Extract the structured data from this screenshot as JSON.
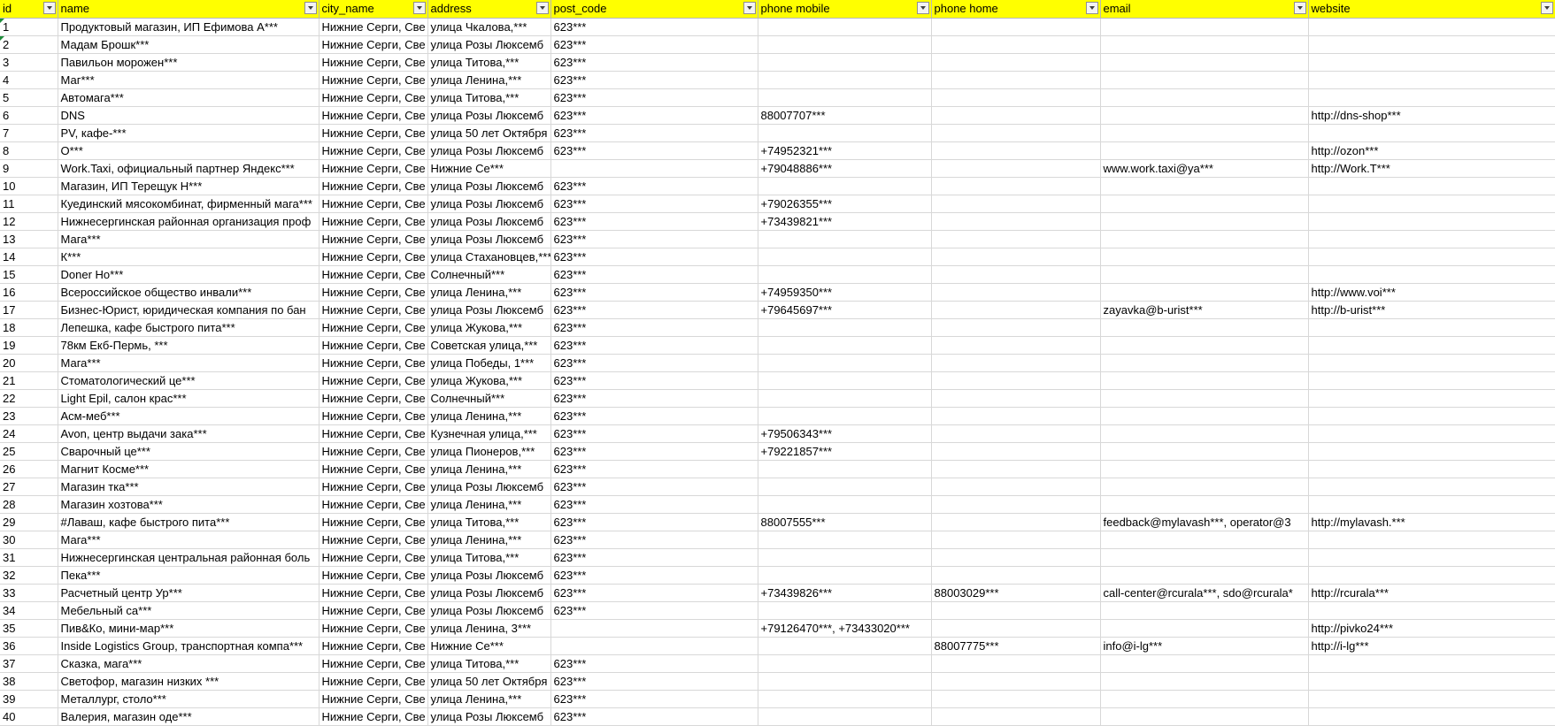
{
  "sheet": {
    "columns": [
      "id",
      "name",
      "city_name",
      "address",
      "post_code",
      "phone mobile",
      "phone home",
      "email",
      "website"
    ],
    "marked_ids": [
      1,
      2
    ],
    "rows": [
      [
        "1",
        "Продуктовый магазин, ИП Ефимова А***",
        "Нижние Серги, Све",
        "улица Чкалова,***",
        "623***",
        "",
        "",
        "",
        ""
      ],
      [
        "2",
        "Мадам Брошк***",
        "Нижние Серги, Све",
        "улица Розы Люксемб",
        "623***",
        "",
        "",
        "",
        ""
      ],
      [
        "3",
        "Павильон морожен***",
        "Нижние Серги, Све",
        "улица Титова,***",
        "623***",
        "",
        "",
        "",
        ""
      ],
      [
        "4",
        "Маг***",
        "Нижние Серги, Све",
        "улица Ленина,***",
        "623***",
        "",
        "",
        "",
        ""
      ],
      [
        "5",
        "Автомага***",
        "Нижние Серги, Све",
        "улица Титова,***",
        "623***",
        "",
        "",
        "",
        ""
      ],
      [
        "6",
        "DNS",
        "Нижние Серги, Све",
        "улица Розы Люксемб",
        "623***",
        "88007707***",
        "",
        "",
        "http://dns-shop***"
      ],
      [
        "7",
        "PV, кафе-***",
        "Нижние Серги, Све",
        "улица 50 лет Октября",
        "623***",
        "",
        "",
        "",
        ""
      ],
      [
        "8",
        "О***",
        "Нижние Серги, Све",
        "улица Розы Люксемб",
        "623***",
        "+74952321***",
        "",
        "",
        "http://ozon***"
      ],
      [
        "9",
        "Work.Taxi, официальный партнер Яндекс***",
        "Нижние Серги, Све",
        "Нижние Се***",
        "",
        "+79048886***",
        "",
        "www.work.taxi@ya***",
        "http://Work.T***"
      ],
      [
        "10",
        "Магазин, ИП Терещук Н***",
        "Нижние Серги, Све",
        "улица Розы Люксемб",
        "623***",
        "",
        "",
        "",
        ""
      ],
      [
        "11",
        "Куединский мясокомбинат, фирменный мага***",
        "Нижние Серги, Све",
        "улица Розы Люксемб",
        "623***",
        "+79026355***",
        "",
        "",
        ""
      ],
      [
        "12",
        "Нижнесергинская районная организация проф",
        "Нижние Серги, Све",
        "улица Розы Люксемб",
        "623***",
        "+73439821***",
        "",
        "",
        ""
      ],
      [
        "13",
        "Мага***",
        "Нижние Серги, Све",
        "улица Розы Люксемб",
        "623***",
        "",
        "",
        "",
        ""
      ],
      [
        "14",
        "К***",
        "Нижние Серги, Све",
        "улица Стахановцев,***",
        "623***",
        "",
        "",
        "",
        ""
      ],
      [
        "15",
        "Doner Ho***",
        "Нижние Серги, Све",
        "Солнечный***",
        "623***",
        "",
        "",
        "",
        ""
      ],
      [
        "16",
        "Всероссийское общество инвали***",
        "Нижние Серги, Све",
        "улица Ленина,***",
        "623***",
        "+74959350***",
        "",
        "",
        "http://www.voi***"
      ],
      [
        "17",
        "Бизнес-Юрист, юридическая компания по бан",
        "Нижние Серги, Све",
        "улица Розы Люксемб",
        "623***",
        "+79645697***",
        "",
        "zayavka@b-urist***",
        "http://b-urist***"
      ],
      [
        "18",
        "Лепешка, кафе быстрого пита***",
        "Нижние Серги, Све",
        "улица Жукова,***",
        "623***",
        "",
        "",
        "",
        ""
      ],
      [
        "19",
        "78км Екб-Пермь, ***",
        "Нижние Серги, Све",
        "Советская улица,***",
        "623***",
        "",
        "",
        "",
        ""
      ],
      [
        "20",
        "Мага***",
        "Нижние Серги, Све",
        "улица Победы, 1***",
        "623***",
        "",
        "",
        "",
        ""
      ],
      [
        "21",
        "Стоматологический це***",
        "Нижние Серги, Све",
        "улица Жукова,***",
        "623***",
        "",
        "",
        "",
        ""
      ],
      [
        "22",
        "Light Epil, салон крас***",
        "Нижние Серги, Све",
        "Солнечный***",
        "623***",
        "",
        "",
        "",
        ""
      ],
      [
        "23",
        "Асм-меб***",
        "Нижние Серги, Све",
        "улица Ленина,***",
        "623***",
        "",
        "",
        "",
        ""
      ],
      [
        "24",
        "Avon, центр выдачи зака***",
        "Нижние Серги, Све",
        "Кузнечная улица,***",
        "623***",
        "+79506343***",
        "",
        "",
        ""
      ],
      [
        "25",
        "Сварочный це***",
        "Нижние Серги, Све",
        "улица Пионеров,***",
        "623***",
        "+79221857***",
        "",
        "",
        ""
      ],
      [
        "26",
        "Магнит Косме***",
        "Нижние Серги, Све",
        "улица Ленина,***",
        "623***",
        "",
        "",
        "",
        ""
      ],
      [
        "27",
        "Магазин тка***",
        "Нижние Серги, Све",
        "улица Розы Люксемб",
        "623***",
        "",
        "",
        "",
        ""
      ],
      [
        "28",
        "Магазин хозтова***",
        "Нижние Серги, Све",
        "улица Ленина,***",
        "623***",
        "",
        "",
        "",
        ""
      ],
      [
        "29",
        "#Лаваш, кафе быстрого пита***",
        "Нижние Серги, Све",
        "улица Титова,***",
        "623***",
        "88007555***",
        "",
        "feedback@mylavash***, operator@3",
        "http://mylavash.***"
      ],
      [
        "30",
        "Мага***",
        "Нижние Серги, Све",
        "улица Ленина,***",
        "623***",
        "",
        "",
        "",
        ""
      ],
      [
        "31",
        "Нижнесергинская центральная районная боль",
        "Нижние Серги, Све",
        "улица Титова,***",
        "623***",
        "",
        "",
        "",
        ""
      ],
      [
        "32",
        "Пека***",
        "Нижние Серги, Све",
        "улица Розы Люксемб",
        "623***",
        "",
        "",
        "",
        ""
      ],
      [
        "33",
        "Расчетный центр Ур***",
        "Нижние Серги, Све",
        "улица Розы Люксемб",
        "623***",
        "+73439826***",
        "88003029***",
        "call-center@rcurala***, sdo@rcurala*",
        "http://rcurala***"
      ],
      [
        "34",
        "Мебельный са***",
        "Нижние Серги, Све",
        "улица Розы Люксемб",
        "623***",
        "",
        "",
        "",
        ""
      ],
      [
        "35",
        "Пив&Ко, мини-мар***",
        "Нижние Серги, Све",
        "улица Ленина, 3***",
        "",
        "+79126470***, +73433020***",
        "",
        "",
        "http://pivko24***"
      ],
      [
        "36",
        "Inside Logistics Group, транспортная компа***",
        "Нижние Серги, Све",
        "Нижние Се***",
        "",
        "",
        "88007775***",
        "info@i-lg***",
        "http://i-lg***"
      ],
      [
        "37",
        "Сказка, мага***",
        "Нижние Серги, Све",
        "улица Титова,***",
        "623***",
        "",
        "",
        "",
        ""
      ],
      [
        "38",
        "Светофор, магазин низких ***",
        "Нижние Серги, Све",
        "улица 50 лет Октября",
        "623***",
        "",
        "",
        "",
        ""
      ],
      [
        "39",
        "Металлург, столо***",
        "Нижние Серги, Све",
        "улица Ленина,***",
        "623***",
        "",
        "",
        "",
        ""
      ],
      [
        "40",
        "Валерия, магазин оде***",
        "Нижние Серги, Све",
        "улица Розы Люксемб",
        "623***",
        "",
        "",
        "",
        ""
      ]
    ]
  },
  "colors": {
    "header_bg": "#ffff00",
    "gridline": "#d8d8d8",
    "error_marker": "#1e8c3a"
  },
  "icons": {
    "filter": "filter-dropdown-icon",
    "cell_marker": "error-triangle-icon"
  }
}
